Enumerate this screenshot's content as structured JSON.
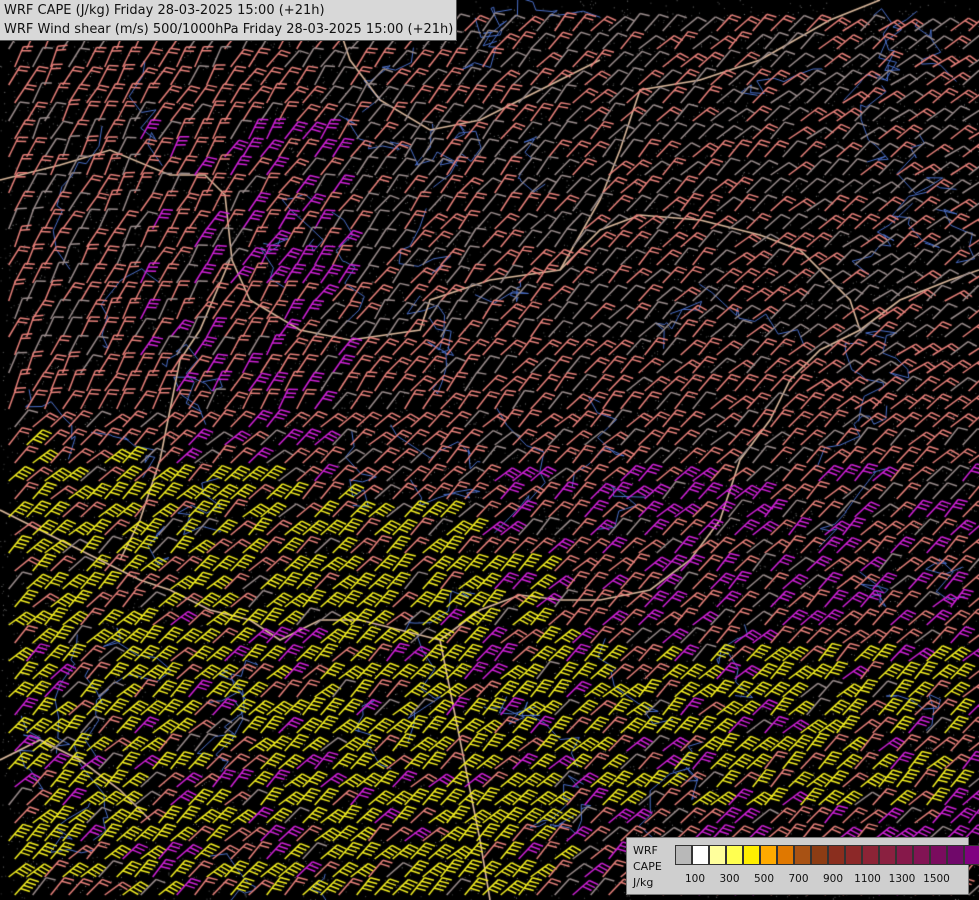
{
  "header": {
    "title_line_1": "WRF CAPE (J/kg) Friday 28-03-2025 15:00 (+21h)",
    "title_line_2": "WRF Wind shear (m/s) 500/1000hPa Friday 28-03-2025 15:00 (+21h)"
  },
  "legend": {
    "label_1": "WRF",
    "label_2": "CAPE",
    "label_3": "J/kg",
    "colors": [
      "#b8b8b8",
      "#ffffff",
      "#ffff9c",
      "#ffff50",
      "#ffee00",
      "#ffaa00",
      "#e07800",
      "#a85214",
      "#8c3c14",
      "#8a2e1e",
      "#8c2828",
      "#8c2436",
      "#8a2040",
      "#86184a",
      "#821454",
      "#7a0c5e",
      "#70086a",
      "#800080"
    ],
    "ticks": [
      "100",
      "300",
      "500",
      "700",
      "900",
      "1100",
      "1300",
      "1500"
    ]
  },
  "map": {
    "background": "#000000",
    "border_color": "#d9b79b",
    "river_color": "#4a6ec8",
    "barb_colors": {
      "light_gray": "#9a8c8c",
      "salmon": "#e8807a",
      "magenta": "#d020d8",
      "yellow": "#f4f020"
    }
  }
}
